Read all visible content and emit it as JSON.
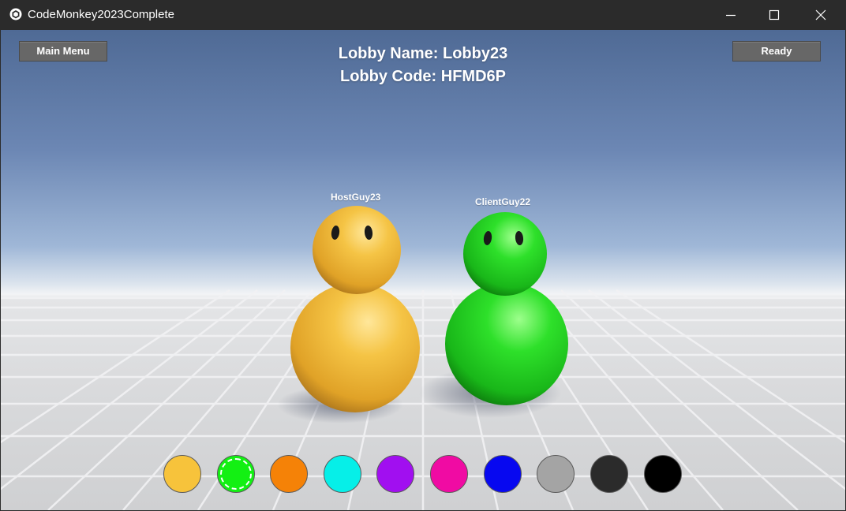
{
  "window": {
    "title": "CodeMonkey2023Complete",
    "icons": {
      "app": "unity-icon",
      "minimize": "minimize-icon",
      "maximize": "maximize-icon",
      "close": "close-icon"
    }
  },
  "hud": {
    "main_menu_label": "Main Menu",
    "ready_label": "Ready",
    "lobby_name": "Lobby Name: Lobby23",
    "lobby_code": "Lobby Code: HFMD6P"
  },
  "players": [
    {
      "name": "HostGuy23",
      "color": "#f0b93a"
    },
    {
      "name": "ClientGuy22",
      "color": "#1fd01f"
    }
  ],
  "color_swatches": [
    {
      "name": "yellow",
      "color": "#f7c33b",
      "selected": false
    },
    {
      "name": "green",
      "color": "#13f013",
      "selected": true
    },
    {
      "name": "orange",
      "color": "#f58207",
      "selected": false
    },
    {
      "name": "cyan",
      "color": "#06efe8",
      "selected": false
    },
    {
      "name": "purple",
      "color": "#a10ff0",
      "selected": false
    },
    {
      "name": "magenta",
      "color": "#f00ba3",
      "selected": false
    },
    {
      "name": "blue",
      "color": "#0708f0",
      "selected": false
    },
    {
      "name": "gray",
      "color": "#a4a4a4",
      "selected": false
    },
    {
      "name": "dark-gray",
      "color": "#2b2b2b",
      "selected": false
    },
    {
      "name": "black",
      "color": "#000000",
      "selected": false
    }
  ]
}
